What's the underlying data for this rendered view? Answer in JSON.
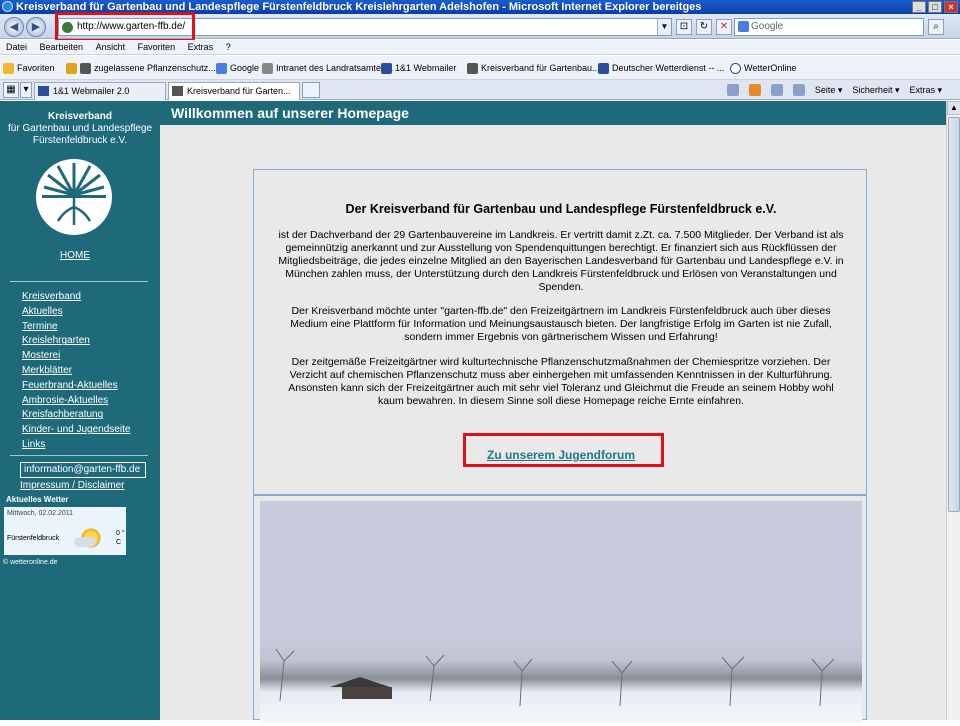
{
  "window": {
    "title": "Kreisverband für Gartenbau und Landespflege Fürstenfeldbruck Kreislehrgarten Adelshofen - Microsoft Internet Explorer bereitges"
  },
  "addressbar": {
    "url": "http://www.garten-ffb.de/",
    "search_placeholder": "Google"
  },
  "menu": [
    "Datei",
    "Bearbeiten",
    "Ansicht",
    "Favoriten",
    "Extras",
    "?"
  ],
  "favorites": {
    "label": "Favoriten",
    "items": [
      "zugelassene Pflanzenschutz...",
      "Google",
      "Intranet des Landratsamtes...",
      "1&1 Webmailer",
      "Kreisverband für Gartenbau...",
      "Deutscher Wetterdienst -- ...",
      "WetterOnline"
    ]
  },
  "tabs": [
    {
      "label": "1&1 Webmailer 2.0",
      "active": false
    },
    {
      "label": "Kreisverband für Garten...",
      "active": true
    }
  ],
  "tools": {
    "seite": "Seite ▾",
    "sicherheit": "Sicherheit ▾",
    "extras": "Extras ▾"
  },
  "sidebar": {
    "head1": "Kreisverband",
    "head2": "für Gartenbau und Landespflege",
    "head3": "Fürstenfeldbruck e.V.",
    "home": "HOME",
    "nav": [
      "Kreisverband",
      "Aktuelles",
      "Termine",
      "Kreislehrgarten",
      "Mosterei",
      "Merkblätter",
      "Feuerbrand-Aktuelles",
      "Ambrosie-Aktuelles",
      "Kreisfachberatung",
      "Kinder- und Jugendseite",
      "Links"
    ],
    "email": "information@garten-ffb.de",
    "impressum": "Impressum / Disclaimer",
    "weather_title": "Aktuelles Wetter",
    "weather_date": "Mittwoch, 02.02.2011",
    "weather_city": "Fürstenfeldbruck",
    "weather_temp": "0 °",
    "weather_unit": "C",
    "copyright": "© wetteronline.de"
  },
  "main": {
    "header": "Willkommen auf unserer Homepage",
    "title": "Der Kreisverband für Gartenbau und Landespflege Fürstenfeldbruck e.V.",
    "p1": "ist der Dachverband der 29 Gartenbauvereine im Landkreis. Er vertritt damit z.Zt. ca. 7.500 Mitglieder. Der Verband ist als gemeinnützig anerkannt und zur Ausstellung von Spendenquittungen berechtigt. Er finanziert sich aus Rückflüssen der Mitgliedsbeiträge, die jedes einzelne Mitglied an den Bayerischen Landesverband für Gartenbau und Landespflege e.V. in München zahlen muss, der Unterstützung durch den Landkreis Fürstenfeldbruck und Erlösen von Veranstaltungen und Spenden.",
    "p2": "Der Kreisverband möchte unter \"garten-ffb.de\" den Freizeitgärtnern im Landkreis Fürstenfeldbruck auch über dieses Medium eine Plattform für Information und Meinungsaustausch bieten. Der langfristige Erfolg im Garten ist nie Zufall, sondern immer Ergebnis von gärtnerischem Wissen und Erfahrung!",
    "p3": "Der zeitgemäße Freizeitgärtner wird kulturtechnische Pflanzenschutzmaßnahmen der Chemiespritze vorziehen. Der Verzicht auf chemischen Pflanzenschutz muss aber einhergehen mit umfassenden Kenntnissen in der Kulturführung. Ansonsten kann sich der Freizeitgärtner auch mit sehr viel Toleranz und Gleichmut die Freude an seinem Hobby wohl kaum bewahren. In diesem Sinne soll diese Homepage reiche Ernte einfahren.",
    "forum_link": "Zu unserem Jugendforum"
  },
  "colors": {
    "teal": "#1e6a7a",
    "highlight": "#e0101a",
    "link": "#1a7a8a"
  }
}
